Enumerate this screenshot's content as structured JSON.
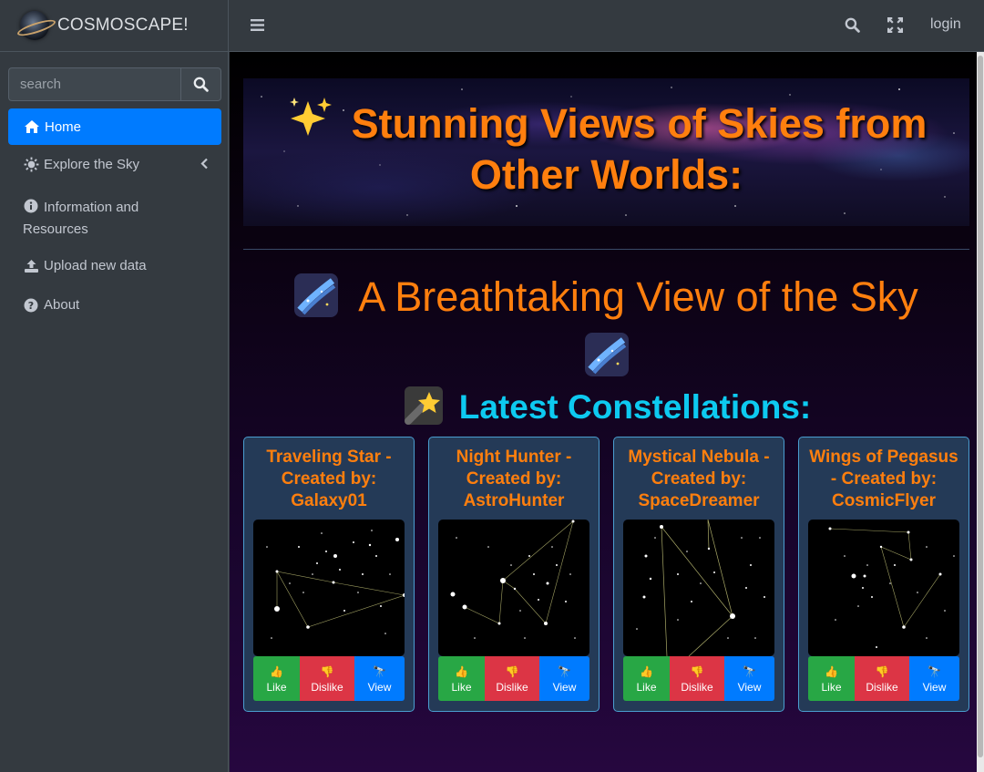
{
  "app": {
    "brand_name": "COSMOSCAPE!"
  },
  "sidebar": {
    "search_placeholder": "search",
    "items": [
      {
        "label": "Home",
        "icon": "home-icon",
        "active": true
      },
      {
        "label": "Explore the Sky",
        "icon": "sun-gear-icon",
        "has_submenu": true
      },
      {
        "label": "Information and Resources",
        "icon": "info-icon"
      },
      {
        "label": "Upload new data",
        "icon": "upload-icon"
      },
      {
        "label": "About",
        "icon": "question-icon"
      }
    ]
  },
  "topbar": {
    "login_label": "login"
  },
  "main": {
    "banner_title": "Stunning Views of Skies from Other Worlds:",
    "subtitle": "A Breathtaking View of the Sky",
    "latest_heading": "Latest Constellations:"
  },
  "cards": [
    {
      "title": "Traveling Star - Created by: Galaxy01",
      "like": "Like",
      "dislike": "Dislike",
      "view": "View"
    },
    {
      "title": "Night Hunter - Created by: AstroHunter",
      "like": "Like",
      "dislike": "Dislike",
      "view": "View"
    },
    {
      "title": "Mystical Nebula - Created by: SpaceDreamer",
      "like": "Like",
      "dislike": "Dislike",
      "view": "View"
    },
    {
      "title": "Wings of Pegasus - Created by: CosmicFlyer",
      "like": "Like",
      "dislike": "Dislike",
      "view": "View"
    }
  ],
  "colors": {
    "accent_orange": "#ff7f0e",
    "accent_cyan": "#0dcaf0",
    "active_nav": "#007bff",
    "like": "#28a745",
    "dislike": "#dc3545",
    "view": "#007bff"
  }
}
